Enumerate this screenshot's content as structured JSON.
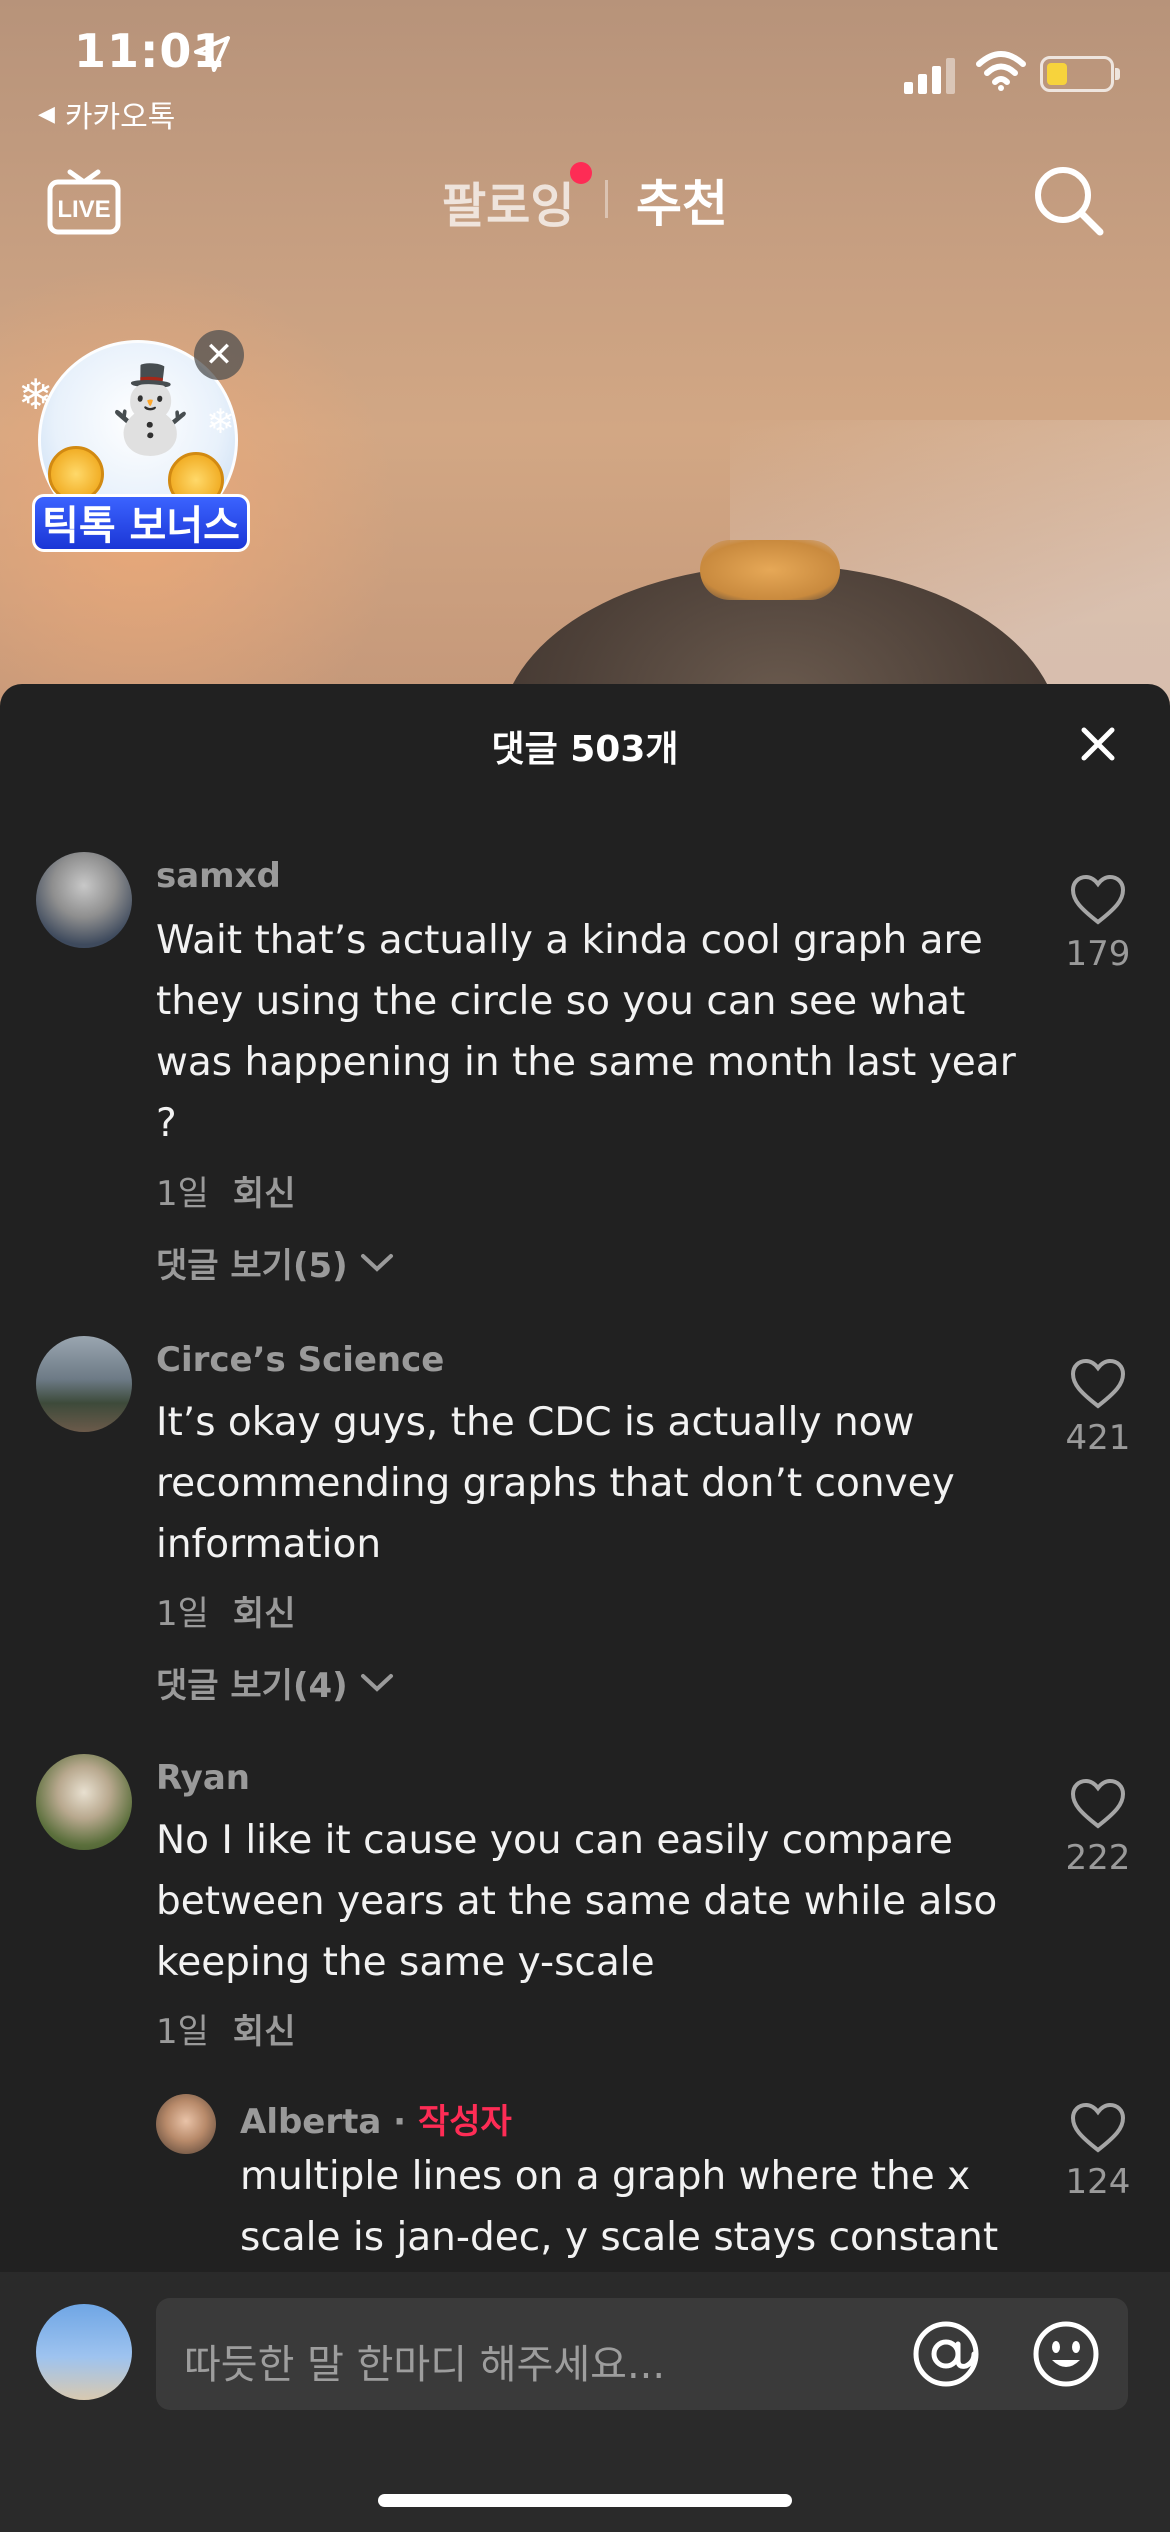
{
  "status_bar": {
    "time": "11:01",
    "back_app": "카카오톡"
  },
  "top_nav": {
    "live_label": "LIVE",
    "tab_following": "팔로잉",
    "tab_for_you": "추천"
  },
  "bonus_widget": {
    "label": "틱톡 보너스"
  },
  "comments_sheet": {
    "title": "댓글 503개",
    "comments": [
      {
        "user": "samxd",
        "text": "Wait that’s actually a kinda cool graph are they using the circle so you can see what was happening in the same month last year ?",
        "age": "1일",
        "reply_label": "회신",
        "view_replies": "댓글 보기(5)",
        "likes": "179"
      },
      {
        "user": "Circe’s Science",
        "text": "It’s okay guys, the CDC is actually now recommending graphs that don’t convey information",
        "age": "1일",
        "reply_label": "회신",
        "view_replies": "댓글 보기(4)",
        "likes": "421"
      },
      {
        "user": "Ryan",
        "text": "No I like it cause you can easily compare between years at the same date while also keeping the same y-scale",
        "age": "1일",
        "reply_label": "회신",
        "likes": "222"
      },
      {
        "user": "Alberta",
        "separator": " · ",
        "badge": "작성자",
        "text": "multiple lines on a graph where the x scale is jan-dec, y scale stays constant",
        "likes": "124"
      }
    ]
  },
  "input_bar": {
    "placeholder": "따듯한 말 한마디 해주세요..."
  },
  "colors": {
    "accent": "#fe2c55",
    "sheet_bg": "#212121",
    "battery": "#f7d33c"
  },
  "icons": [
    "location-arrow-icon",
    "signal-icon",
    "wifi-icon",
    "battery-icon",
    "live-icon",
    "search-icon",
    "close-icon",
    "heart-icon",
    "chevron-down-icon",
    "at-icon",
    "emoji-icon"
  ]
}
